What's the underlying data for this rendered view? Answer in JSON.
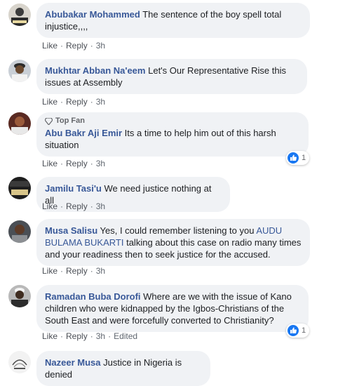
{
  "comments": [
    {
      "author": "Abubakar Mohammed",
      "text": "The sentence of the boy spell total injustice,,,,",
      "actions": {
        "like": "Like",
        "reply": "Reply",
        "time": "3h"
      }
    },
    {
      "author": "Mukhtar Abban Na'eem",
      "text": "Let's Our Representative Rise this issues at Assembly",
      "actions": {
        "like": "Like",
        "reply": "Reply",
        "time": "3h"
      }
    },
    {
      "badge": "Top Fan",
      "author": "Abu Bakr Aji Emir",
      "text": "Its a time to help him out of this harsh situation",
      "actions": {
        "like": "Like",
        "reply": "Reply",
        "time": "3h"
      },
      "reaction_count": "1"
    },
    {
      "author": "Jamilu Tasi'u",
      "text": "We need justice nothing at all",
      "actions": {
        "like": "Like",
        "reply": "Reply",
        "time": "3h"
      }
    },
    {
      "author": "Musa Salisu",
      "text": "Yes, I could remember listening to you",
      "mention": "AUDU BULAMA BUKARTI",
      "text_after": "talking about this case on radio many times and your readiness then to seek justice for the accused.",
      "actions": {
        "like": "Like",
        "reply": "Reply",
        "time": "3h"
      }
    },
    {
      "author": "Ramadan Buba Dorofi",
      "text": "Where are we with the issue of Kano children who were kidnapped by the Igbos-Christians of the South East and were forcefully converted to Christianity?",
      "actions": {
        "like": "Like",
        "reply": "Reply",
        "time": "3h",
        "edited": "Edited"
      },
      "reaction_count": "1"
    },
    {
      "author": "Nazeer Musa",
      "text": "Justice in Nigeria is denied"
    }
  ],
  "colors": {
    "author": "#385898",
    "bubble": "#f0f2f5",
    "like_blue": "#1877f2"
  }
}
